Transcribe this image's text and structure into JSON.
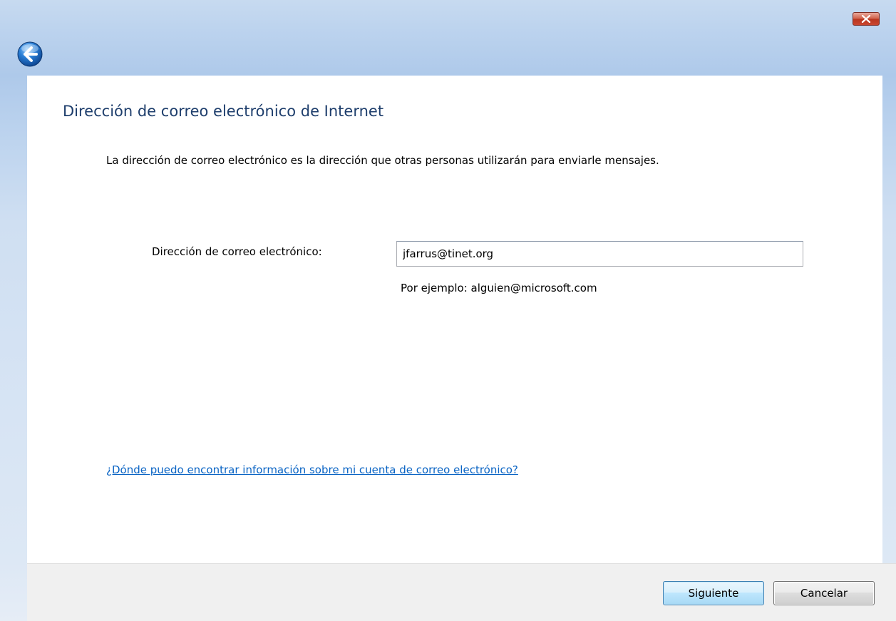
{
  "window": {
    "close_icon": "close-icon",
    "back_icon": "back-arrow-icon"
  },
  "page": {
    "title": "Dirección de correo electrónico de Internet",
    "description": "La dirección de correo electrónico es la dirección que otras personas utilizarán para enviarle mensajes."
  },
  "form": {
    "email_label": "Dirección de correo electrónico:",
    "email_value": "jfarrus@tinet.org",
    "example": "Por ejemplo: alguien@microsoft.com"
  },
  "help": {
    "link_text": "¿Dónde puedo encontrar información sobre mi cuenta de correo electrónico?"
  },
  "footer": {
    "next_label": "Siguiente",
    "cancel_label": "Cancelar"
  },
  "colors": {
    "title": "#1e3e6c",
    "link": "#0a64c4",
    "close_button": "#c9462f",
    "titlebar": "#bcd3ee"
  }
}
